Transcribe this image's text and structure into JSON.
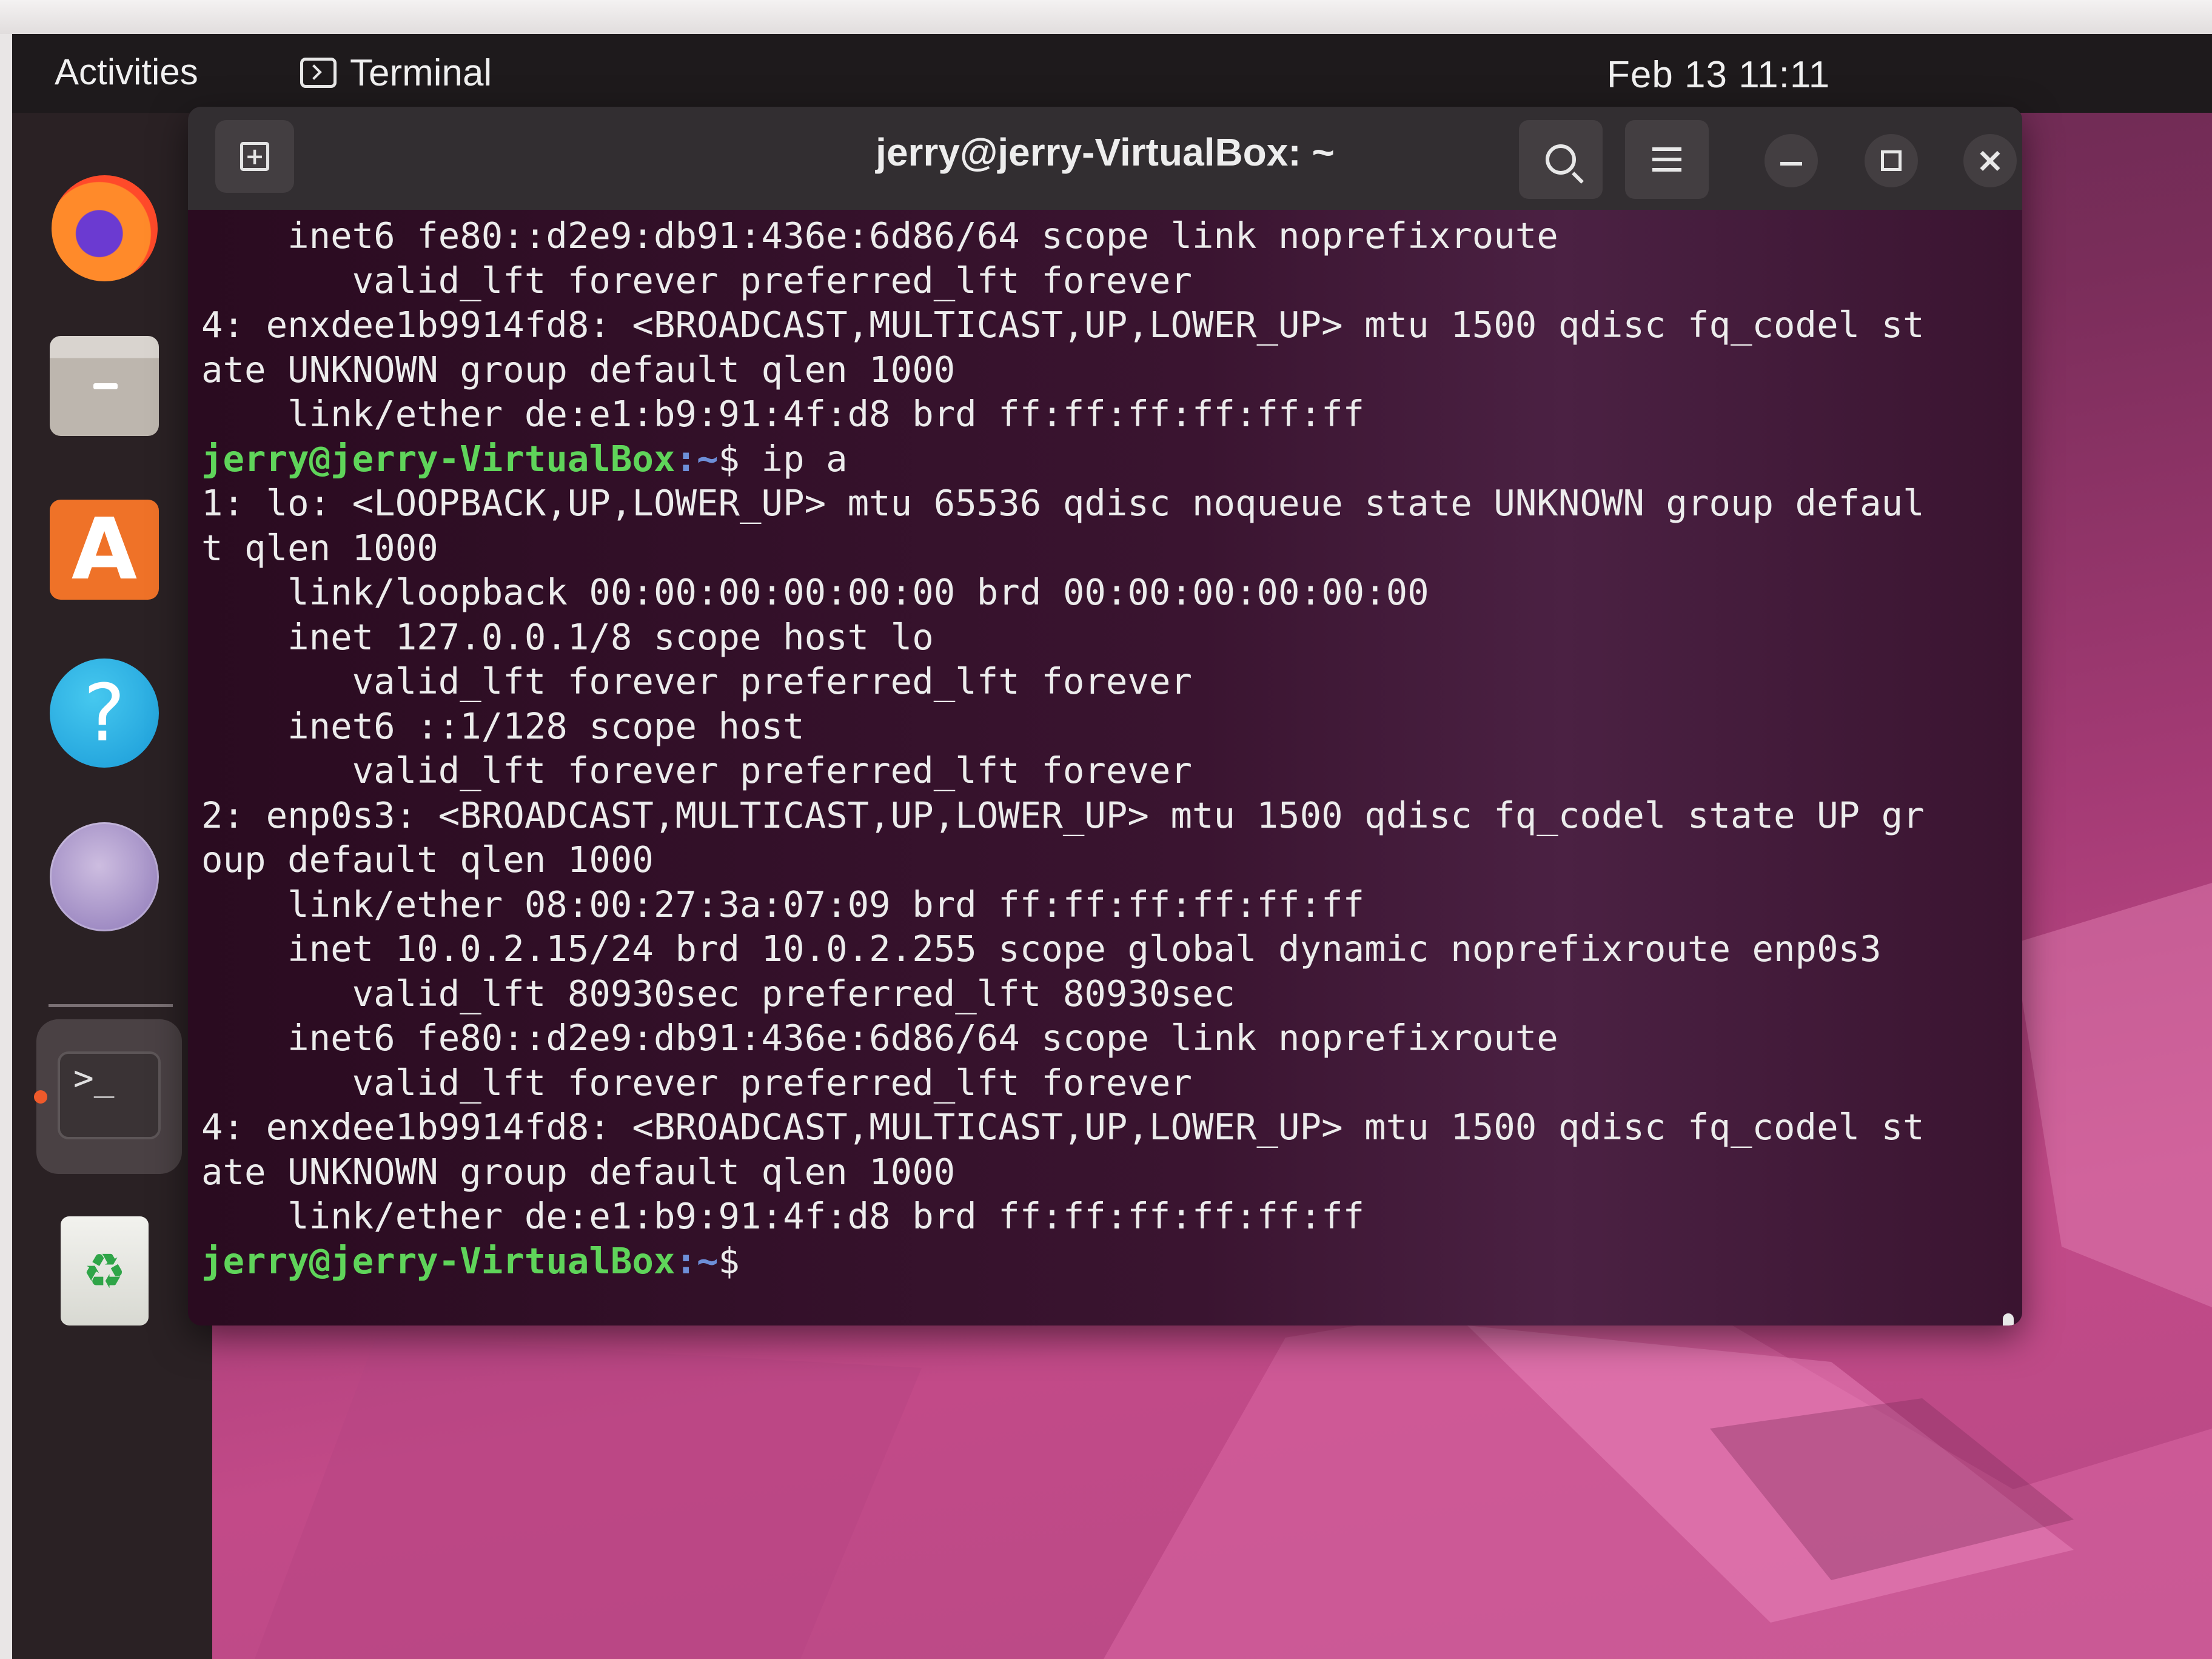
{
  "topbar": {
    "activities_label": "Activities",
    "app_name": "Terminal",
    "clock": "Feb 13  11:11"
  },
  "dock": {
    "items": [
      {
        "name": "Firefox",
        "icon": "firefox-icon"
      },
      {
        "name": "Files",
        "icon": "files-icon"
      },
      {
        "name": "Ubuntu Software",
        "icon": "app-store-icon",
        "glyph": "A"
      },
      {
        "name": "Help",
        "icon": "help-icon",
        "glyph": "?"
      },
      {
        "name": "Network",
        "icon": "network-icon"
      },
      {
        "name": "Terminal",
        "icon": "terminal-icon",
        "glyph": ">_",
        "active": true
      },
      {
        "name": "Trash",
        "icon": "trash-icon",
        "glyph": "♻"
      }
    ]
  },
  "terminal": {
    "title": "jerry@jerry-VirtualBox: ~",
    "new_tab_glyph": "+",
    "close_glyph": "×",
    "prompt": {
      "user_host": "jerry@jerry-VirtualBox",
      "path": ":~",
      "symbol": "$"
    },
    "lines": [
      {
        "type": "out",
        "text": "    inet6 fe80::d2e9:db91:436e:6d86/64 scope link noprefixroute"
      },
      {
        "type": "out",
        "text": "       valid_lft forever preferred_lft forever"
      },
      {
        "type": "out",
        "text": "4: enxdee1b9914fd8: <BROADCAST,MULTICAST,UP,LOWER_UP> mtu 1500 qdisc fq_codel st"
      },
      {
        "type": "out",
        "text": "ate UNKNOWN group default qlen 1000"
      },
      {
        "type": "out",
        "text": "    link/ether de:e1:b9:91:4f:d8 brd ff:ff:ff:ff:ff:ff"
      },
      {
        "type": "prompt",
        "user": "jerry@jerry-VirtualBox",
        "path": ":~",
        "cmd": "$ ip a"
      },
      {
        "type": "out",
        "text": "1: lo: <LOOPBACK,UP,LOWER_UP> mtu 65536 qdisc noqueue state UNKNOWN group defaul"
      },
      {
        "type": "out",
        "text": "t qlen 1000"
      },
      {
        "type": "out",
        "text": "    link/loopback 00:00:00:00:00:00 brd 00:00:00:00:00:00"
      },
      {
        "type": "out",
        "text": "    inet 127.0.0.1/8 scope host lo"
      },
      {
        "type": "out",
        "text": "       valid_lft forever preferred_lft forever"
      },
      {
        "type": "out",
        "text": "    inet6 ::1/128 scope host"
      },
      {
        "type": "out",
        "text": "       valid_lft forever preferred_lft forever"
      },
      {
        "type": "out",
        "text": "2: enp0s3: <BROADCAST,MULTICAST,UP,LOWER_UP> mtu 1500 qdisc fq_codel state UP gr"
      },
      {
        "type": "out",
        "text": "oup default qlen 1000"
      },
      {
        "type": "out",
        "text": "    link/ether 08:00:27:3a:07:09 brd ff:ff:ff:ff:ff:ff"
      },
      {
        "type": "out",
        "text": "    inet 10.0.2.15/24 brd 10.0.2.255 scope global dynamic noprefixroute enp0s3"
      },
      {
        "type": "out",
        "text": "       valid_lft 80930sec preferred_lft 80930sec"
      },
      {
        "type": "out",
        "text": "    inet6 fe80::d2e9:db91:436e:6d86/64 scope link noprefixroute"
      },
      {
        "type": "out",
        "text": "       valid_lft forever preferred_lft forever"
      },
      {
        "type": "out",
        "text": "4: enxdee1b9914fd8: <BROADCAST,MULTICAST,UP,LOWER_UP> mtu 1500 qdisc fq_codel st"
      },
      {
        "type": "out",
        "text": "ate UNKNOWN group default qlen 1000"
      },
      {
        "type": "out",
        "text": "    link/ether de:e1:b9:91:4f:d8 brd ff:ff:ff:ff:ff:ff"
      },
      {
        "type": "prompt",
        "user": "jerry@jerry-VirtualBox",
        "path": ":~",
        "cmd": "$"
      }
    ]
  },
  "colors": {
    "topbar_bg": "#1e1a1c",
    "terminal_bg": "#2c0e22",
    "prompt_user": "#5fd45a",
    "prompt_path": "#6d8fd8",
    "accent_dot": "#ee5a2b"
  }
}
